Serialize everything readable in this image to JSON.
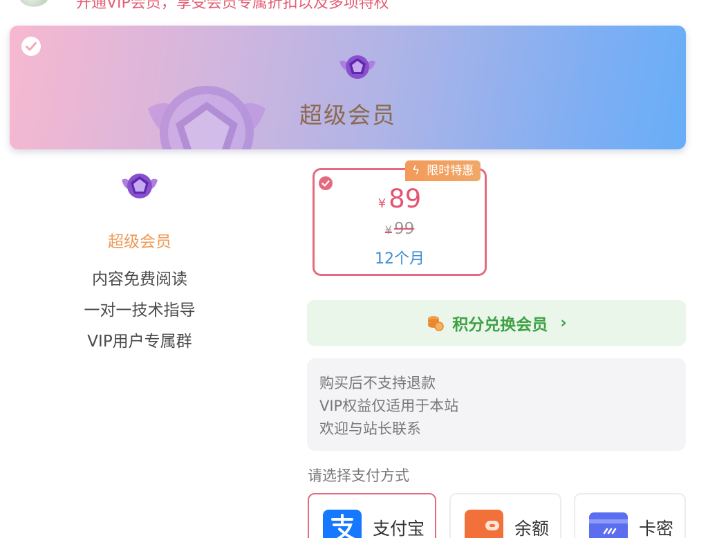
{
  "top_bar": {
    "text": "开通VIP会员，享受会员专属折扣以及多项特权"
  },
  "hero": {
    "title": "超级会员"
  },
  "left_panel": {
    "name": "超级会员",
    "benefits": [
      "内容免费阅读",
      "一对一技术指导",
      "VIP用户专属群"
    ]
  },
  "plan": {
    "promo_tag": "限时特惠",
    "currency": "¥",
    "price": "89",
    "original_price": "99",
    "period": "12个月"
  },
  "points_exchange": {
    "label": "积分兑换会员",
    "arrow": "›"
  },
  "notes": [
    "购买后不支持退款",
    "VIP权益仅适用于本站",
    "欢迎与站长联系"
  ],
  "payment": {
    "label": "请选择支付方式",
    "options": [
      {
        "name": "支付宝",
        "icon": "alipay-icon",
        "color": "#1677ff"
      },
      {
        "name": "余额",
        "icon": "wallet-icon",
        "color": "#f2713a"
      },
      {
        "name": "卡密",
        "icon": "card-icon",
        "color": "#5b6ef0"
      }
    ]
  },
  "colors": {
    "accent_pink": "#e46b7f",
    "price_red": "#e65372",
    "period_blue": "#3f8fd3",
    "points_green": "#3ea144",
    "member_orange": "#ee9a57"
  }
}
